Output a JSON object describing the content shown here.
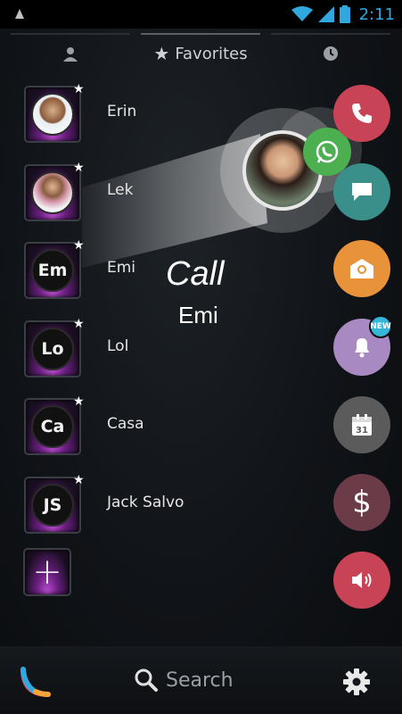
{
  "status": {
    "time": "2:11"
  },
  "tabs": [
    {
      "icon": "person-icon",
      "label": ""
    },
    {
      "icon": "star-icon",
      "label": "Favorites"
    },
    {
      "icon": "clock-icon",
      "label": ""
    }
  ],
  "contacts": [
    {
      "name": "Erin",
      "initials": "",
      "photo": true
    },
    {
      "name": "Lek",
      "initials": "",
      "photo": true
    },
    {
      "name": "Emi",
      "initials": "Em",
      "photo": false
    },
    {
      "name": "Lol",
      "initials": "Lo",
      "photo": false
    },
    {
      "name": "Casa",
      "initials": "Ca",
      "photo": false
    },
    {
      "name": "Jack Salvo",
      "initials": "JS",
      "photo": false
    }
  ],
  "add_contact": {
    "label": "+"
  },
  "overlay": {
    "action": "Call",
    "contact": "Emi"
  },
  "actions": [
    {
      "name": "phone",
      "color": "#c94356"
    },
    {
      "name": "message",
      "color": "#3a8f8a"
    },
    {
      "name": "email",
      "color": "#e8923a"
    },
    {
      "name": "reminder",
      "color": "#a889c2",
      "badge": "NEW"
    },
    {
      "name": "calendar",
      "color": "#5b5b5b",
      "calendar_day": "31"
    },
    {
      "name": "payment",
      "color": "#6b3b47",
      "symbol": "$"
    },
    {
      "name": "speaker",
      "color": "#c94356"
    }
  ],
  "bottom": {
    "search_label": "Search"
  }
}
